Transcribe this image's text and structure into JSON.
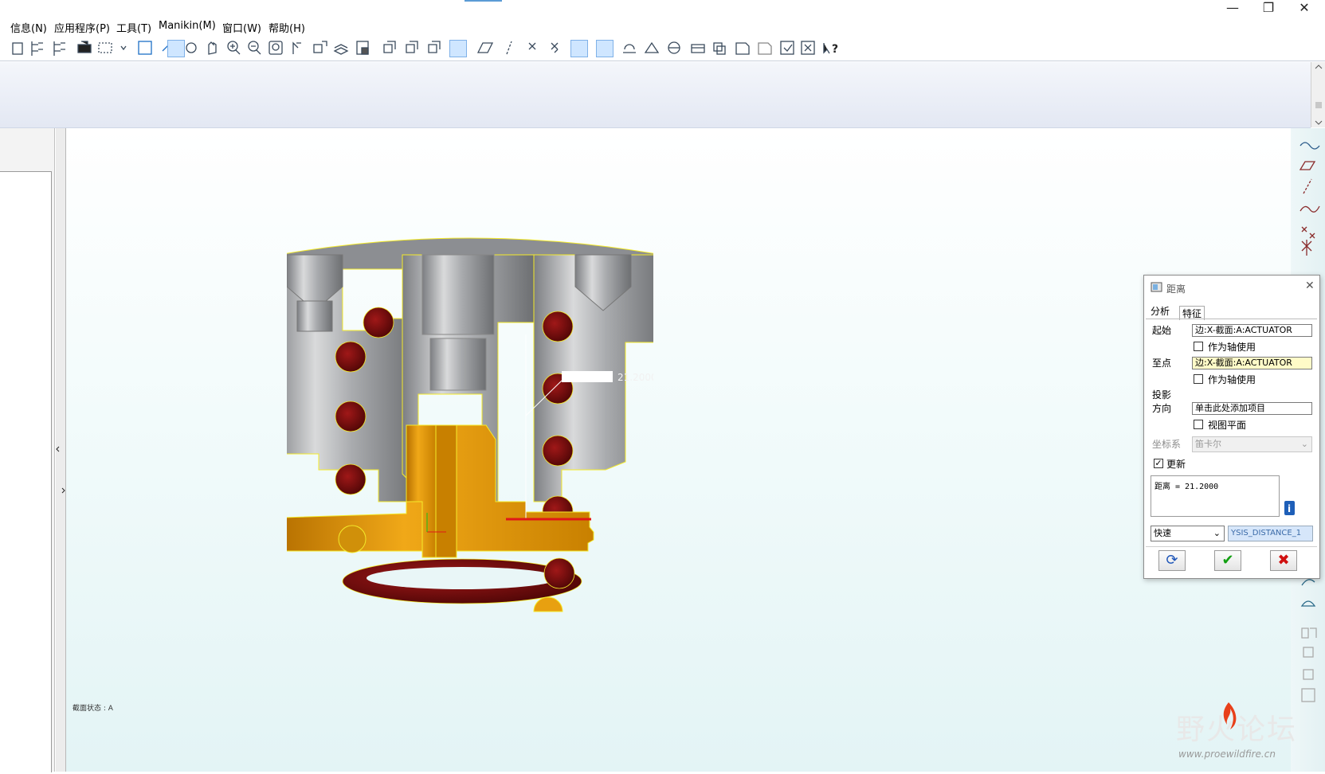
{
  "menu": {
    "items": [
      "信息(N)",
      "应用程序(P)",
      "工具(T)",
      "Manikin(M)",
      "窗口(W)",
      "帮助(H)"
    ]
  },
  "window_controls": {
    "minimize": "—",
    "restore": "❐",
    "close": "✕"
  },
  "viewport": {
    "status_label": "截面状态 : A",
    "distance_annotation": "21.2000"
  },
  "dialog": {
    "title": "距离",
    "tabs": [
      "分析",
      "特征"
    ],
    "from_label": "起始",
    "from_value": "边:X-截面:A:ACTUATOR",
    "from_axis_label": "作为轴使用",
    "to_label": "至点",
    "to_value": "边:X-截面:A:ACTUATOR",
    "to_axis_label": "作为轴使用",
    "projection_label_1": "投影",
    "projection_label_2": "方向",
    "projection_value": "单击此处添加项目",
    "view_plane_label": "视图平面",
    "csys_label": "坐标系",
    "csys_value": "笛卡尔",
    "update_label": "更新",
    "update_checked": true,
    "result_text": "距离 = 21.2000",
    "mode_value": "快速",
    "feature_name": "YSIS_DISTANCE_1"
  },
  "watermark": {
    "text": "野火论坛",
    "url": "www.proewildfire.cn"
  },
  "colors": {
    "part_gray": "#a8aaad",
    "spring": "#6e0a0a",
    "actuator": "#e8a010",
    "edge_highlight": "#f4ea2a",
    "accent": "#5b9bd5"
  }
}
